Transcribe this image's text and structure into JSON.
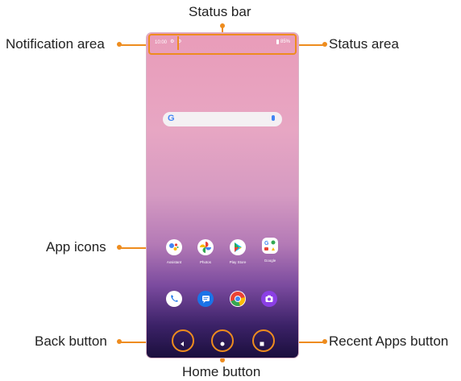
{
  "labels": {
    "status_bar": "Status bar",
    "notification_area": "Notification area",
    "status_area": "Status area",
    "app_icons": "App icons",
    "back_button": "Back button",
    "home_button": "Home button",
    "recent_apps_button": "Recent Apps button"
  },
  "phone": {
    "status": {
      "time": "10:00",
      "battery": "85%"
    },
    "apps": [
      {
        "label": "Assistant",
        "icon": "assistant-icon"
      },
      {
        "label": "Photos",
        "icon": "photos-icon"
      },
      {
        "label": "Play Store",
        "icon": "play-store-icon"
      },
      {
        "label": "Google",
        "icon": "google-icon"
      }
    ],
    "dock": [
      {
        "icon": "phone-icon",
        "color": "#1a73e8"
      },
      {
        "icon": "messages-icon",
        "color": "#1a73e8"
      },
      {
        "icon": "chrome-icon",
        "color": "#ea4335"
      },
      {
        "icon": "camera-icon",
        "color": "#8b3fe5"
      }
    ]
  },
  "colors": {
    "accent": "#ee8c1e"
  }
}
